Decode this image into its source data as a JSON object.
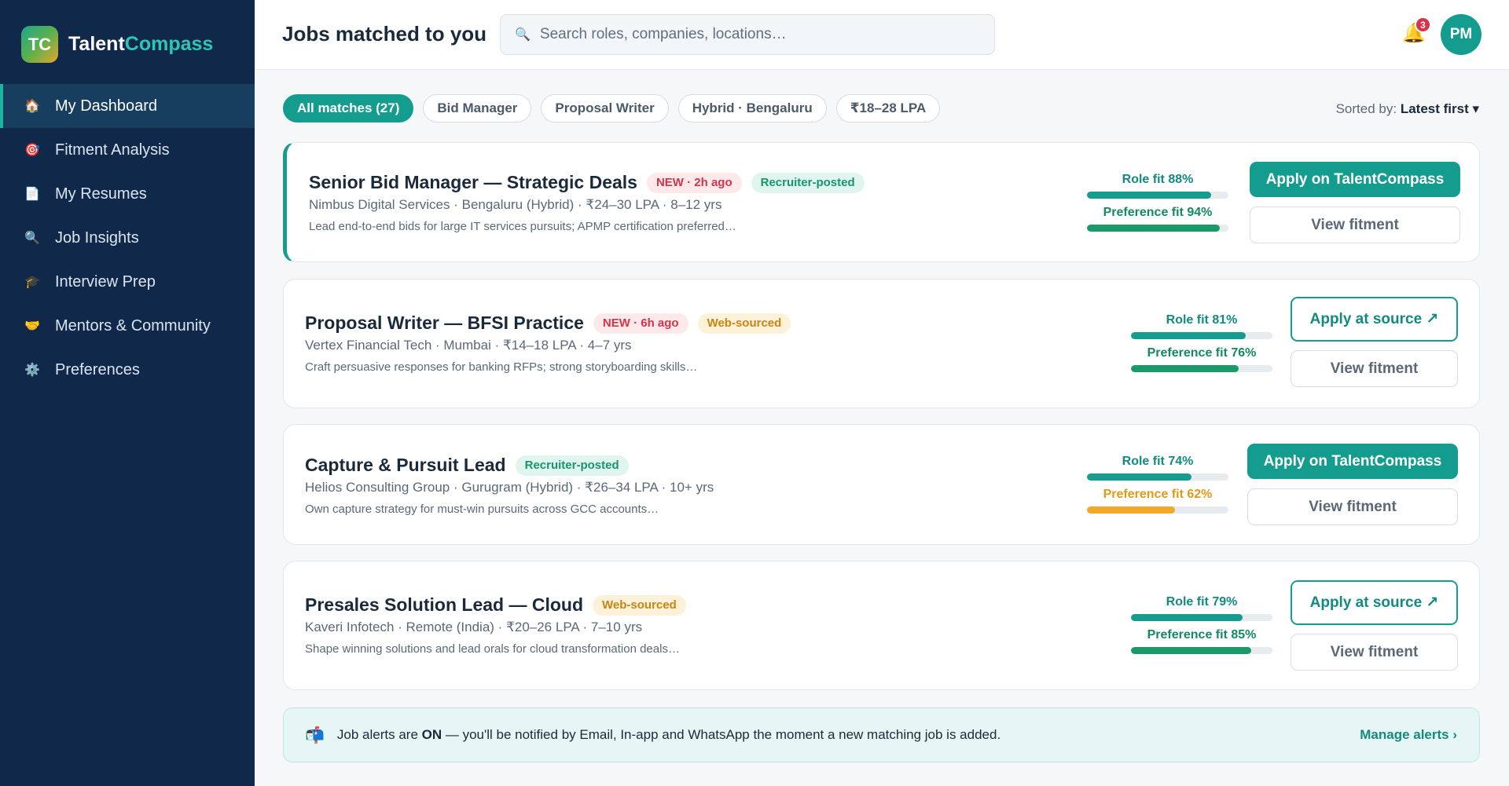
{
  "brand": {
    "logo": "TC",
    "name_part1": "Talent",
    "name_part2": "Compass"
  },
  "sidebar": {
    "items": [
      {
        "label": "My Dashboard",
        "icon": "🏠",
        "icon_name": "home-icon",
        "active": true
      },
      {
        "label": "Fitment Analysis",
        "icon": "🎯",
        "icon_name": "target-icon"
      },
      {
        "label": "My Resumes",
        "icon": "📄",
        "icon_name": "document-icon"
      },
      {
        "label": "Job Insights",
        "icon": "🔍",
        "icon_name": "magnifier-icon"
      },
      {
        "label": "Interview Prep",
        "icon": "🎓",
        "icon_name": "graduation-cap-icon"
      },
      {
        "label": "Mentors & Community",
        "icon": "🤝",
        "icon_name": "handshake-icon"
      },
      {
        "label": "Preferences",
        "icon": "⚙️",
        "icon_name": "gear-icon"
      }
    ]
  },
  "header": {
    "title": "Jobs matched to you",
    "search_placeholder": "Search roles, companies, locations…",
    "search_icon": "🔍",
    "bell_icon": "🔔",
    "notification_count": "3",
    "avatar_initials": "PM"
  },
  "filters": {
    "chips": [
      "All matches (27)",
      "Bid Manager",
      "Proposal Writer",
      "Hybrid · Bengaluru",
      "₹18–28 LPA"
    ],
    "sort_label": "Sorted by:",
    "sort_value": "Latest first ▾"
  },
  "jobs": [
    {
      "title": "Senior Bid Manager — Strategic Deals",
      "new_badge": "NEW · 2h ago",
      "source_badge": "Recruiter-posted",
      "meta": "Nimbus Digital Services · Bengaluru (Hybrid) · ₹24–30 LPA · 8–12 yrs",
      "desc": "Lead end-to-end bids for large IT services pursuits; APMP certification preferred…",
      "role_fit_label": "Role fit 88%",
      "role_fit": 0.88,
      "pref_fit_label": "Preference fit 94%",
      "pref_fit": 0.94,
      "apply_label": "Apply on TalentCompass",
      "view_label": "View fitment"
    },
    {
      "title": "Proposal Writer — BFSI Practice",
      "new_badge": "NEW · 6h ago",
      "source_badge": "Web-sourced",
      "meta": "Vertex Financial Tech · Mumbai · ₹14–18 LPA · 4–7 yrs",
      "desc": "Craft persuasive responses for banking RFPs; strong storyboarding skills…",
      "role_fit_label": "Role fit 81%",
      "role_fit": 0.81,
      "pref_fit_label": "Preference fit 76%",
      "pref_fit": 0.76,
      "apply_label": "Apply at source ↗",
      "view_label": "View fitment"
    },
    {
      "title": "Capture & Pursuit Lead",
      "source_badge": "Recruiter-posted",
      "meta": "Helios Consulting Group · Gurugram (Hybrid) · ₹26–34 LPA · 10+ yrs",
      "desc": "Own capture strategy for must-win pursuits across GCC accounts…",
      "role_fit_label": "Role fit 74%",
      "role_fit": 0.74,
      "pref_fit_label": "Preference fit 62%",
      "pref_fit": 0.62,
      "apply_label": "Apply on TalentCompass",
      "view_label": "View fitment"
    },
    {
      "title": "Presales Solution Lead — Cloud",
      "source_badge": "Web-sourced",
      "meta": "Kaveri Infotech · Remote (India) · ₹20–26 LPA · 7–10 yrs",
      "desc": "Shape winning solutions and lead orals for cloud transformation deals…",
      "role_fit_label": "Role fit 79%",
      "role_fit": 0.79,
      "pref_fit_label": "Preference fit 85%",
      "pref_fit": 0.85,
      "apply_label": "Apply at source ↗",
      "view_label": "View fitment"
    }
  ],
  "alert": {
    "icon": "📬",
    "text_before": "Job alerts are ",
    "text_strong": "ON",
    "text_after": " — you'll be notified by Email, In-app and WhatsApp the moment a new matching job is added.",
    "manage_label": "Manage alerts ›"
  }
}
